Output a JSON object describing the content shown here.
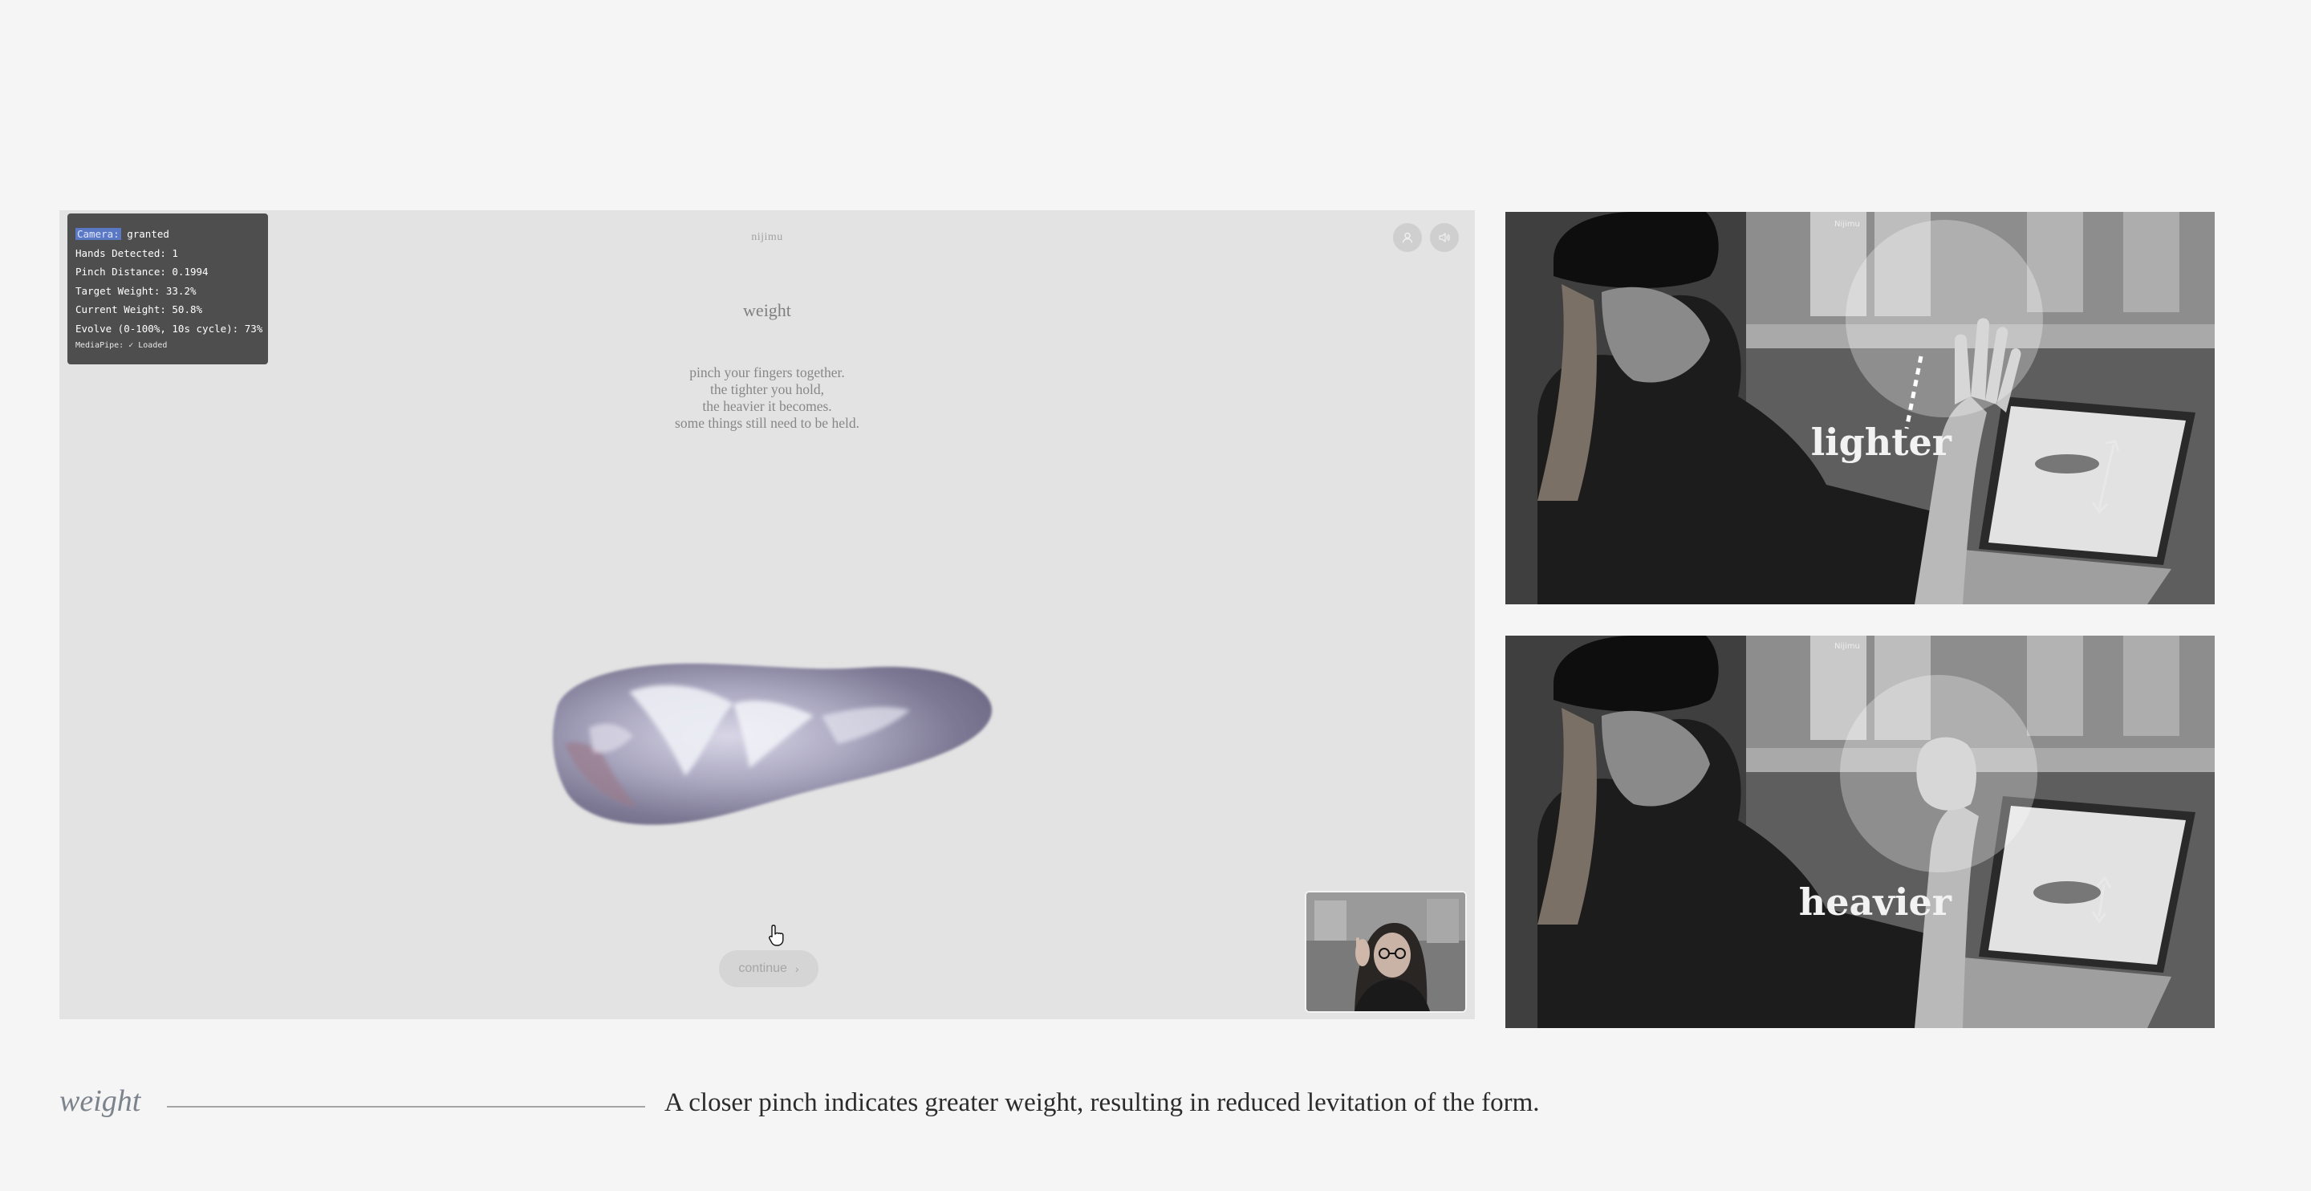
{
  "debug": {
    "camera_label": "Camera:",
    "camera_value": " granted",
    "hands": "Hands Detected: 1",
    "pinch": "Pinch Distance: 0.1994",
    "target": "Target Weight: 33.2%",
    "current": "Current Weight: 50.8%",
    "evolve": "Evolve (0-100%, 10s cycle): 73%",
    "mediapipe": "MediaPipe: ✓ Loaded"
  },
  "app": {
    "brand": "nijimu",
    "title": "weight",
    "poem": [
      "pinch your fingers together.",
      "the tighter you hold,",
      "the heavier it becomes.",
      "some things still need to be held."
    ],
    "continue_label": "continue",
    "continue_chevron": "›",
    "icons": [
      "user-icon",
      "sound-icon"
    ]
  },
  "photos": [
    {
      "label": "lighter",
      "screen_brand": "Nijimu"
    },
    {
      "label": "heavier",
      "screen_brand": "Nijimu"
    }
  ],
  "caption": {
    "title": "weight",
    "text": "A closer pinch indicates greater weight, resulting in reduced levitation of the form."
  },
  "colors": {
    "page_bg": "#f5f5f5",
    "app_bg": "#e3e3e3",
    "debug_bg": "#4e4e4e",
    "highlight": "#5b78c4"
  }
}
